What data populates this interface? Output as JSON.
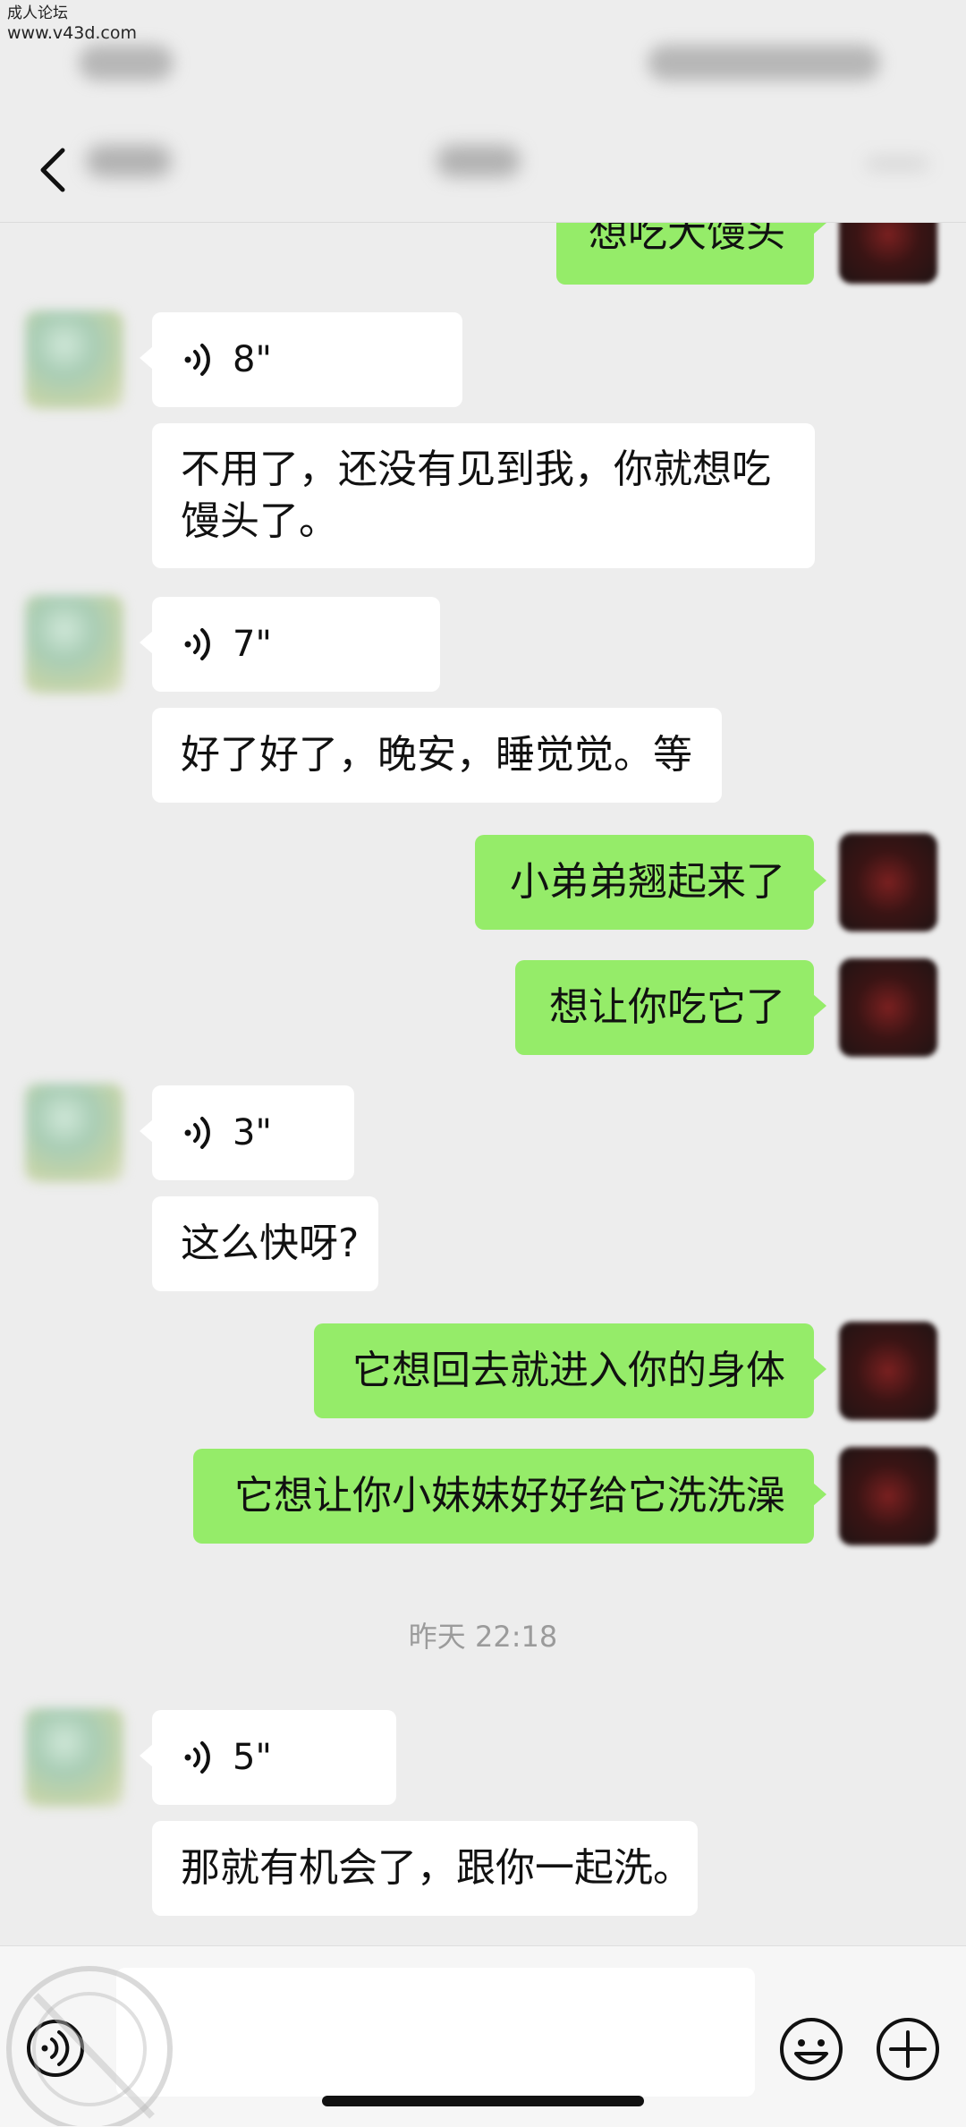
{
  "watermark": {
    "line1": "成人论坛",
    "line2": "www.v43d.com"
  },
  "nav": {
    "back_icon": "chevron-left-icon"
  },
  "messages": [
    {
      "side": "right",
      "type": "text",
      "text": "想吃大馒头"
    },
    {
      "side": "left",
      "type": "voice",
      "duration": "8\""
    },
    {
      "side": "left",
      "type": "text",
      "line1": "不用了，还没有见到我，你就想吃",
      "line2": "馒头了。"
    },
    {
      "side": "left",
      "type": "voice",
      "duration": "7\""
    },
    {
      "side": "left",
      "type": "text",
      "text": "好了好了，晚安，睡觉觉。等"
    },
    {
      "side": "right",
      "type": "text",
      "text": "小弟弟翘起来了"
    },
    {
      "side": "right",
      "type": "text",
      "text": "想让你吃它了"
    },
    {
      "side": "left",
      "type": "voice",
      "duration": "3\""
    },
    {
      "side": "left",
      "type": "text",
      "text": "这么快呀?"
    },
    {
      "side": "right",
      "type": "text",
      "text": "它想回去就进入你的身体"
    },
    {
      "side": "right",
      "type": "text",
      "text": "它想让你小妹妹好好给它洗洗澡"
    },
    {
      "side": "left",
      "type": "voice",
      "duration": "5\""
    },
    {
      "side": "left",
      "type": "text",
      "text": "那就有机会了，跟你一起洗。"
    }
  ],
  "timestamp": "昨天 22:18",
  "input_bar": {
    "voice_icon": "voice-toggle-icon",
    "input_value": "",
    "emoji_icon": "emoji-icon",
    "plus_icon": "plus-circle-icon"
  },
  "colors": {
    "background": "#ededed",
    "sent_bubble": "#95ec69",
    "received_bubble": "#ffffff",
    "timestamp": "#9b9b9b"
  }
}
